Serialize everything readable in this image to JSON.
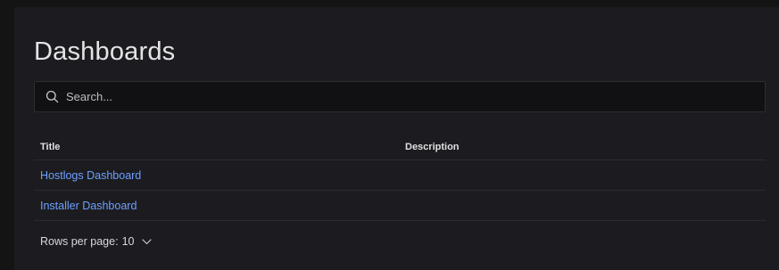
{
  "page": {
    "title": "Dashboards"
  },
  "search": {
    "placeholder": "Search...",
    "value": ""
  },
  "table": {
    "columns": [
      "Title",
      "Description"
    ],
    "rows": [
      {
        "title": "Hostlogs Dashboard",
        "description": ""
      },
      {
        "title": "Installer Dashboard",
        "description": ""
      }
    ]
  },
  "pagination": {
    "label": "Rows per page:",
    "value": "10"
  },
  "icons": {
    "search": "search-icon",
    "chevron": "chevron-down-icon"
  },
  "colors": {
    "background": "#141414",
    "panel": "#1c1c20",
    "link": "#6e9fff",
    "text": "#e4e4e6"
  }
}
